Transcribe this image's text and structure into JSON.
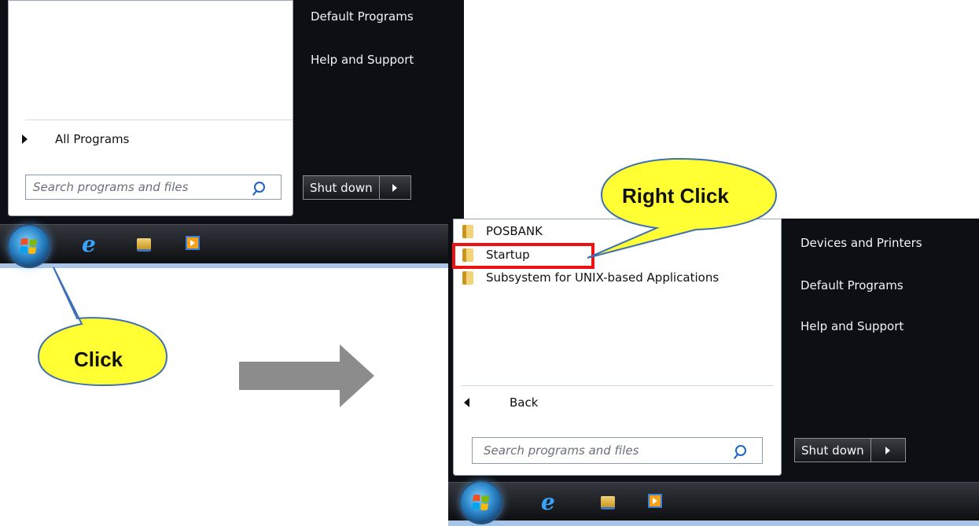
{
  "left_menu": {
    "right_items": [
      "Default Programs",
      "Help and Support"
    ],
    "all_programs_label": "All Programs",
    "search_placeholder": "Search programs and files",
    "shutdown_label": "Shut down"
  },
  "right_menu": {
    "folders": [
      "POSBANK",
      "Startup",
      "Subsystem for UNIX-based Applications"
    ],
    "right_items": [
      "Devices and Printers",
      "Default Programs",
      "Help and Support"
    ],
    "back_label": "Back",
    "search_placeholder": "Search programs and files",
    "shutdown_label": "Shut down"
  },
  "taskbar_icons": [
    "start-orb-icon",
    "internet-explorer-icon",
    "folder-icon",
    "media-player-icon"
  ],
  "callouts": {
    "click": "Click",
    "right_click": "Right Click"
  },
  "colors": {
    "callout_fill": "#ffff33",
    "callout_stroke": "#3f6fb3",
    "highlight": "#ee1111",
    "arrow": "#8c8c8c"
  }
}
